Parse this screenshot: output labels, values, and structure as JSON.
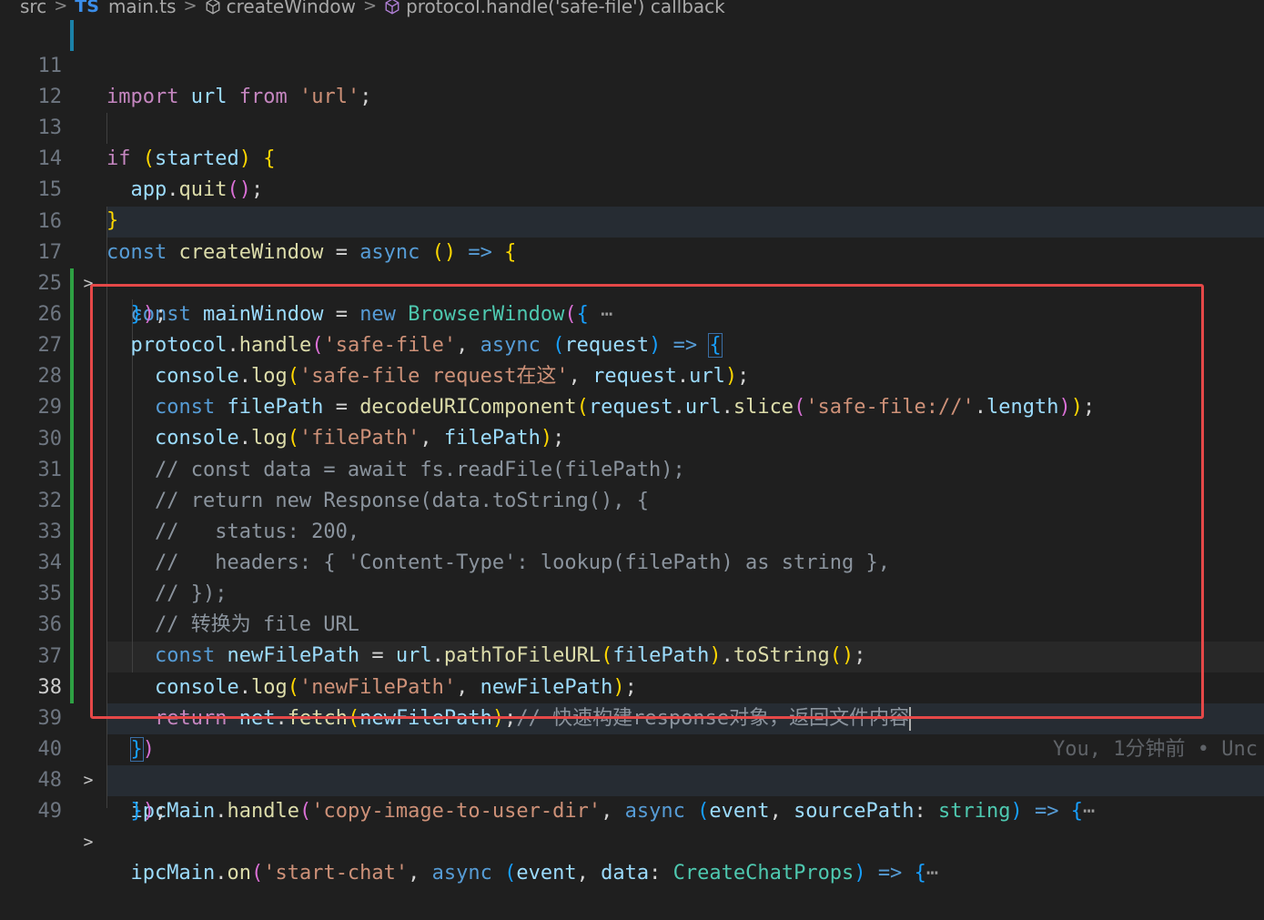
{
  "breadcrumb": {
    "folder": "src",
    "lang_badge": "TS",
    "file": "main.ts",
    "symbol1": "createWindow",
    "symbol2": "protocol.handle('safe-file') callback"
  },
  "lines": {
    "l11": "11",
    "l12": "12",
    "l13": "13",
    "l14": "14",
    "l15": "15",
    "l16": "16",
    "l17": "17",
    "l25": "25",
    "l26": "26",
    "l27": "27",
    "l28": "28",
    "l29": "29",
    "l30": "30",
    "l31": "31",
    "l32": "32",
    "l33": "33",
    "l34": "34",
    "l35": "35",
    "l36": "36",
    "l37": "37",
    "l38": "38",
    "l39": "39",
    "l40": "40",
    "l48": "48",
    "l49": "49"
  },
  "code": {
    "c30": "// const data = await fs.readFile(filePath);",
    "c31": "// return new Response(data.toString(), {",
    "c32": "//   status: 200,",
    "c33": "//   headers: { 'Content-Type': lookup(filePath) as string },",
    "c34": "// });",
    "c35": "// 转换为 file URL",
    "c38": "// 快速构建response对象，返回文件内容",
    "s27": "'safe-file request在这'",
    "s26": "'safe-file'",
    "s28": "'safe-file://'",
    "s29": "'filePath'",
    "s37": "'newFilePath'",
    "s40": "'copy-image-to-user-dir'",
    "s49": "'start-chat'",
    "s11": "'url'"
  },
  "blame": "You, 1分钟前 • Unc",
  "colors": {
    "background": "#1f1f1f",
    "highlight_border": "#e54848",
    "git_added": "#2ea043"
  }
}
